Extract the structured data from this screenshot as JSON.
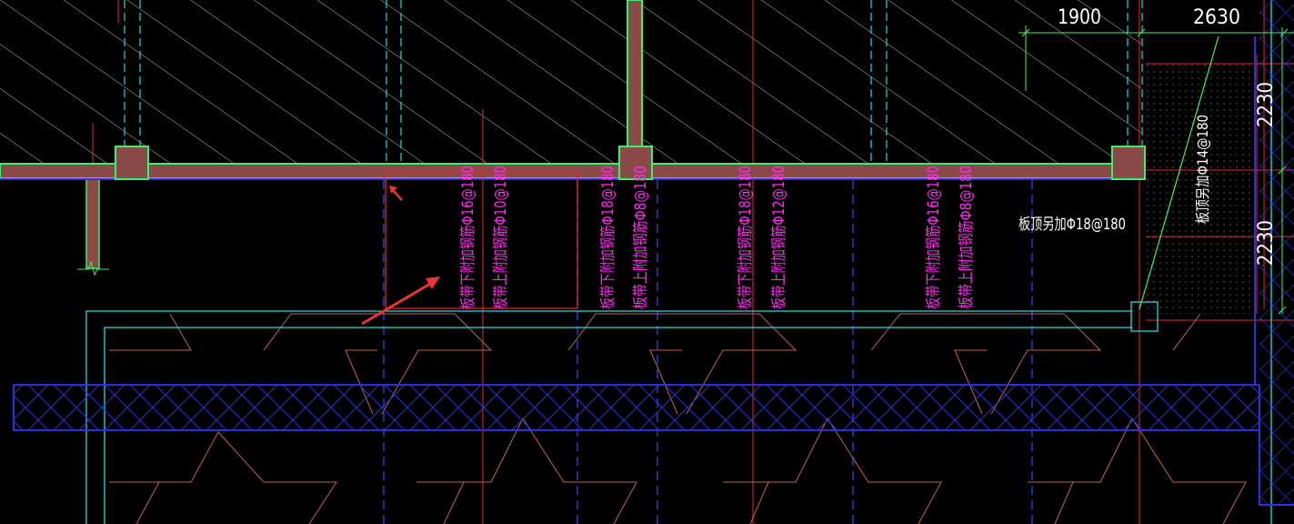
{
  "colors": {
    "background": "#000000",
    "hatch": "#cfcfcf",
    "beam_fill": "#8a4a4a",
    "beam_edge": "#3cf06e",
    "column_edge": "#3cf06e",
    "axis_red": "#e8282d",
    "cyan": "#29d6e6",
    "blue": "#2a32e0",
    "magenta": "#ff2bf0",
    "white_text": "#ffffff",
    "dimension_green": "#3cf06e",
    "stair_outline": "#c0605a",
    "arrow": "#ee3333"
  },
  "dimensions": {
    "top_left": "1900",
    "top_right": "2630",
    "right_upper": "2230",
    "right_lower": "2230"
  },
  "slab_notes": {
    "top_addition": "板顶另加Φ18@180",
    "vertical_top_addition": "板顶另加Φ14@180"
  },
  "rebar_notes": [
    {
      "bottom": "板带下附加钢筋Φ16@180",
      "top": "板带上附加钢筋Φ10@180"
    },
    {
      "bottom": "板带下附加钢筋Φ18@180",
      "top": "板带上附加钢筋Φ8@180"
    },
    {
      "bottom": "板带下附加钢筋Φ18@180",
      "top": "板带上附加钢筋Φ12@180"
    },
    {
      "bottom": "板带下附加钢筋Φ16@180",
      "top": "板带上附加钢筋Φ8@180"
    }
  ],
  "icons": {
    "annotation_arrow_large": "arrow-icon",
    "annotation_arrow_small": "arrow-icon"
  }
}
